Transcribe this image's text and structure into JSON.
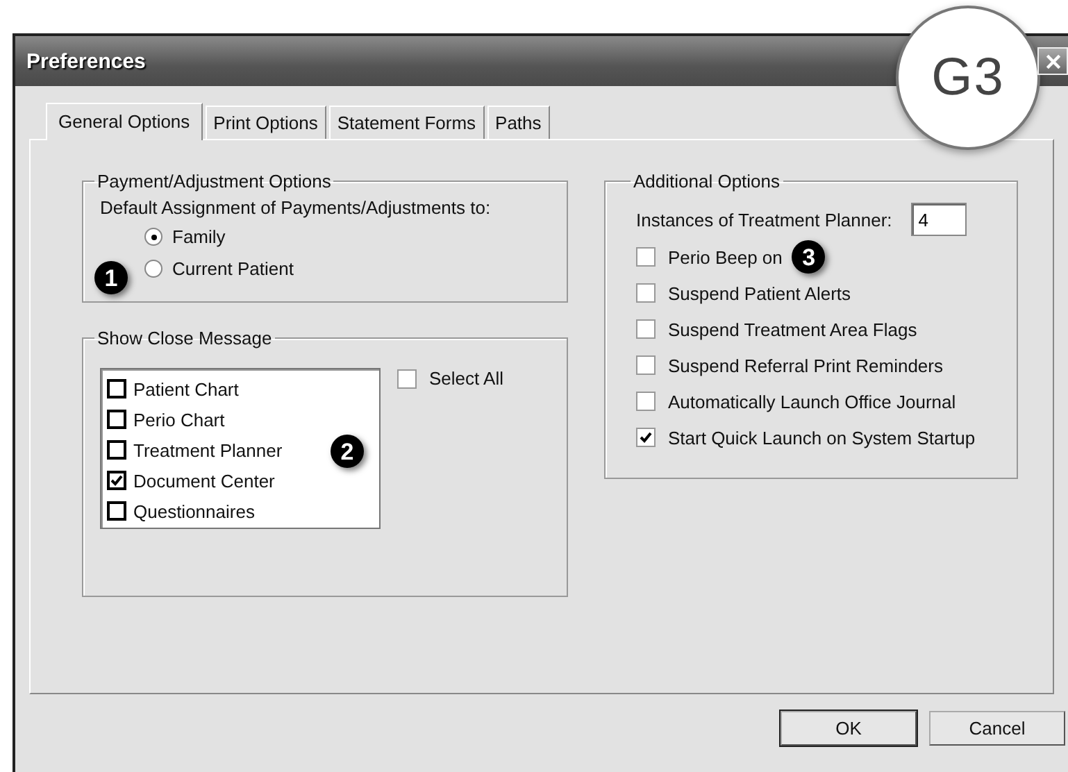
{
  "window": {
    "title": "Preferences",
    "badge": "G3"
  },
  "tabs": [
    {
      "label": "General Options",
      "selected": true
    },
    {
      "label": "Print Options",
      "selected": false
    },
    {
      "label": "Statement Forms",
      "selected": false
    },
    {
      "label": "Paths",
      "selected": false
    }
  ],
  "payment_group": {
    "title": "Payment/Adjustment Options",
    "prompt": "Default Assignment of Payments/Adjustments to:",
    "callout": "1",
    "options": [
      {
        "label": "Family",
        "selected": true
      },
      {
        "label": "Current Patient",
        "selected": false
      }
    ]
  },
  "close_message_group": {
    "title": "Show Close Message",
    "callout": "2",
    "items": [
      {
        "label": "Patient Chart",
        "checked": false
      },
      {
        "label": "Perio Chart",
        "checked": false
      },
      {
        "label": "Treatment Planner",
        "checked": false
      },
      {
        "label": "Document Center",
        "checked": true
      },
      {
        "label": "Questionnaires",
        "checked": false
      }
    ],
    "select_all": {
      "label": "Select All",
      "checked": false
    }
  },
  "additional_group": {
    "title": "Additional Options",
    "instances": {
      "label": "Instances of Treatment Planner:",
      "value": "4"
    },
    "options": [
      {
        "label": "Perio Beep on",
        "checked": false,
        "callout": "3"
      },
      {
        "label": "Suspend Patient Alerts",
        "checked": false
      },
      {
        "label": "Suspend Treatment Area Flags",
        "checked": false
      },
      {
        "label": "Suspend Referral Print Reminders",
        "checked": false
      },
      {
        "label": "Automatically Launch Office Journal",
        "checked": false
      },
      {
        "label": "Start Quick Launch on System Startup",
        "checked": true
      }
    ]
  },
  "buttons": [
    {
      "label": "OK",
      "default": true
    },
    {
      "label": "Cancel",
      "default": false
    }
  ]
}
